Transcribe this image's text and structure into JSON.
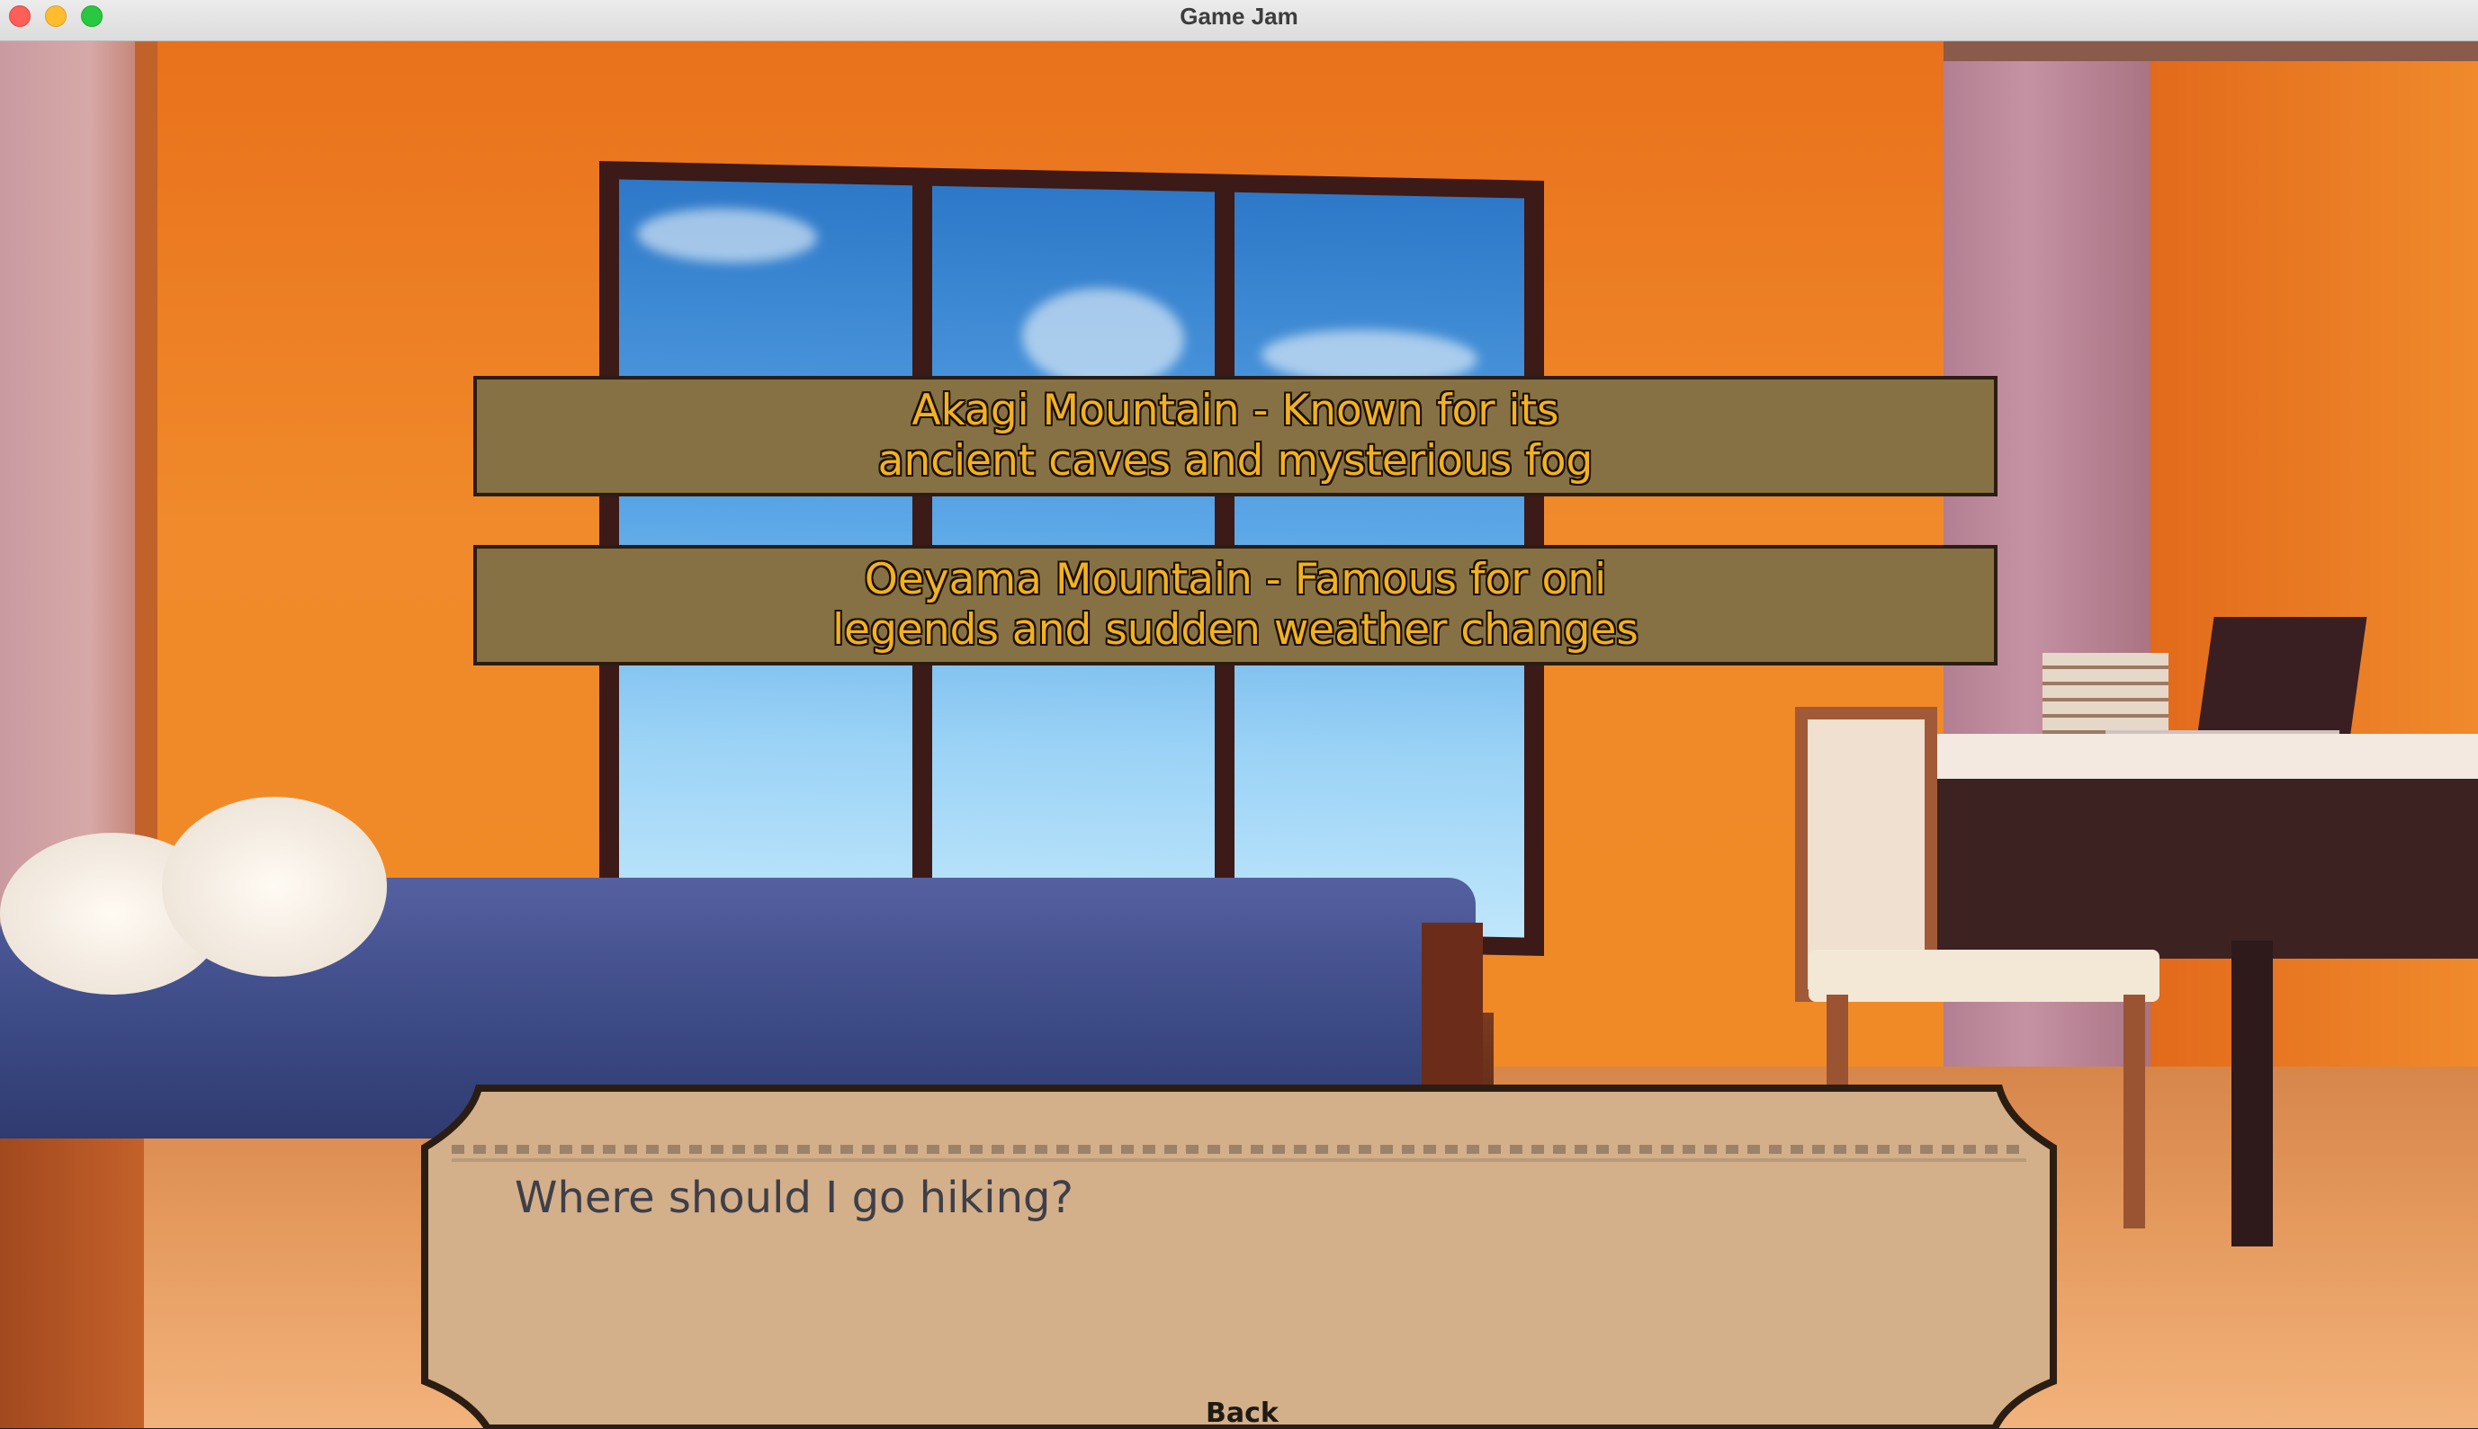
{
  "window": {
    "title": "Game Jam"
  },
  "choices": [
    {
      "label": "Akagi Mountain - Known for its\nancient caves and mysterious fog"
    },
    {
      "label": "Oeyama Mountain - Famous for oni\nlegends and sudden weather changes"
    }
  ],
  "dialogue": {
    "text": "Where should I go hiking?"
  },
  "controls": {
    "back_label": "Back"
  },
  "colors": {
    "choice_fill": "#857143",
    "choice_text": "#f2b21f",
    "dialog_fill": "#d3b08a",
    "dialog_border": "#2c1d12"
  }
}
